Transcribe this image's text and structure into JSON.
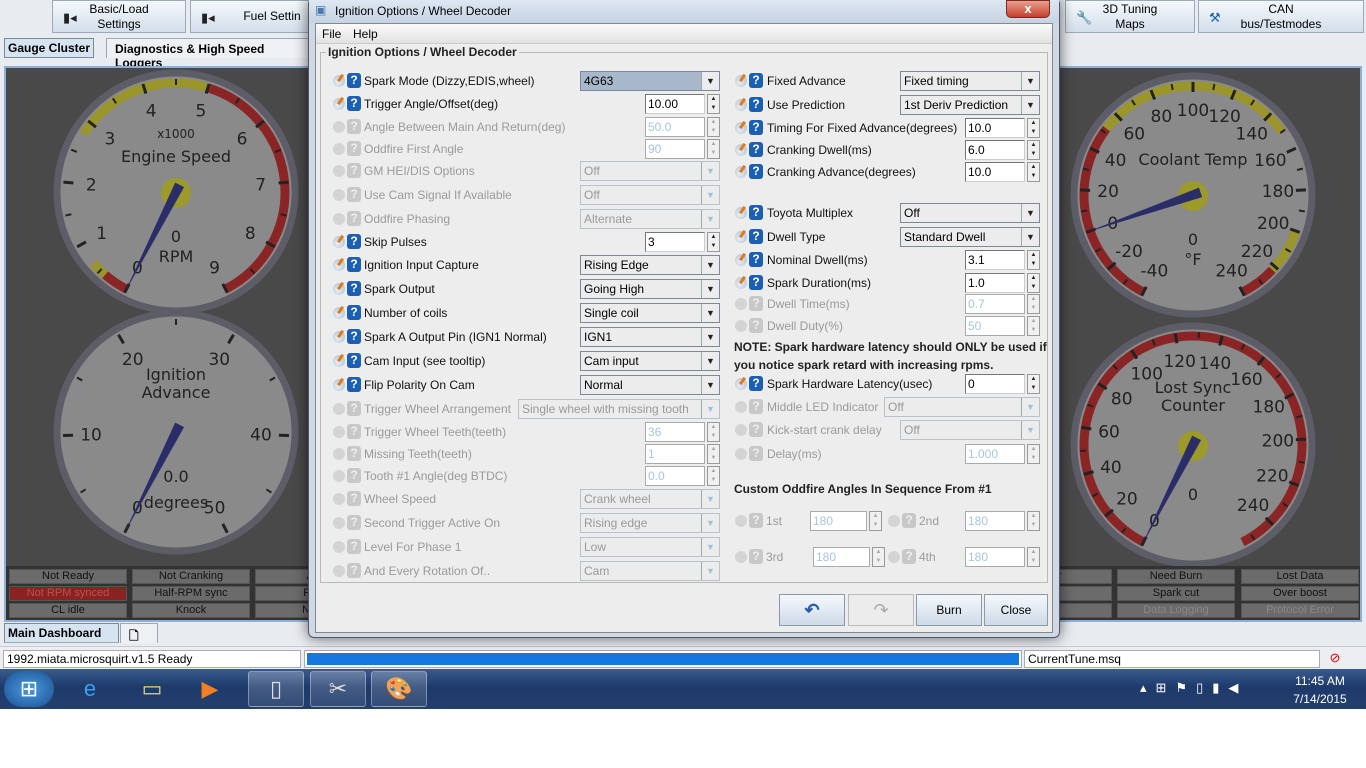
{
  "toolbar": {
    "buttons": [
      {
        "label_l1": "Basic/Load",
        "label_l2": "Settings",
        "icon": "settings-icon"
      },
      {
        "label_l1": "Fuel Settin",
        "label_l2": "",
        "icon": "settings-icon"
      },
      {
        "label_l1": "3D Tuning",
        "label_l2": "Maps",
        "icon": "wrench-icon"
      },
      {
        "label_l1": "CAN",
        "label_l2": "bus/Testmodes",
        "icon": "tools-icon"
      }
    ]
  },
  "tabs": [
    {
      "label": "Gauge Cluster",
      "selected": true
    },
    {
      "label": "Diagnostics & High Speed Loggers",
      "selected": false
    }
  ],
  "gauges": [
    {
      "name": "engine-speed",
      "title": [
        "Engine Speed"
      ],
      "subtitle": "x1000",
      "value_text": "0",
      "units": "RPM",
      "min": 0,
      "max": 9,
      "value": 0,
      "labels": [
        0,
        1,
        2,
        3,
        4,
        5,
        6,
        7,
        8,
        9
      ],
      "minor": 2,
      "hub": true,
      "bands": [
        {
          "from": 0,
          "to": 0.4,
          "color": "#8b2525"
        },
        {
          "from": 0.4,
          "to": 0.65,
          "color": "#9a962a"
        },
        {
          "from": 2.8,
          "to": 5,
          "color": "#9a962a"
        },
        {
          "from": 5,
          "to": 9,
          "color": "#8b2525"
        }
      ]
    },
    {
      "name": "ignition-advance",
      "title": [
        "Ignition",
        "Advance"
      ],
      "subtitle": "",
      "value_text": "0.0",
      "units": "degrees",
      "min": 0,
      "max": 50,
      "value": 0,
      "labels": [
        0,
        10,
        20,
        30,
        40,
        50
      ],
      "minor": 2,
      "hub": false,
      "bands": []
    },
    {
      "name": "coolant-temp",
      "title": [
        "Coolant Temp"
      ],
      "subtitle": "",
      "value_text": "0",
      "units": "°F",
      "min": -40,
      "max": 240,
      "value": 0,
      "labels": [
        -40,
        -20,
        0,
        20,
        40,
        60,
        80,
        100,
        120,
        140,
        160,
        180,
        200,
        220,
        240
      ],
      "minor": 2,
      "hub": true,
      "bands": [
        {
          "from": -40,
          "to": 52,
          "color": "#8b2525"
        },
        {
          "from": 52,
          "to": 150,
          "color": "#9a962a"
        },
        {
          "from": 200,
          "to": 222,
          "color": "#9a962a"
        },
        {
          "from": 222,
          "to": 240,
          "color": "#8b2525"
        }
      ]
    },
    {
      "name": "lost-sync-counter",
      "title": [
        "Lost Sync",
        "Counter"
      ],
      "subtitle": "",
      "value_text": "0",
      "units": "",
      "min": 0,
      "max": 255,
      "value": 0,
      "labels": [
        0,
        20,
        40,
        60,
        80,
        100,
        120,
        140,
        160,
        180,
        200,
        220,
        240
      ],
      "minor": 2,
      "hub": true,
      "bands": [
        {
          "from": 0,
          "to": 255,
          "color": "#8b2525"
        }
      ]
    }
  ],
  "indicators_left": [
    [
      "Not Ready",
      "Not Cranking",
      "AS"
    ],
    [
      "Not RPM synced",
      "Half-RPM sync",
      "Fuel"
    ],
    [
      "CL idle",
      "Knock",
      "No F"
    ]
  ],
  "indicators_right": [
    [
      "rror",
      "Need Burn",
      "Lost Data"
    ],
    [
      "ift",
      "Spark cut",
      "Over boost"
    ],
    [
      "",
      "Data Logging",
      "Protocol Error"
    ]
  ],
  "indicator_states": {
    "red": "Not RPM synced",
    "disabled": [
      "Data Logging",
      "Protocol Error"
    ]
  },
  "dashboard_tabs": {
    "main": "Main Dashboard"
  },
  "status": {
    "left": "1992.miata.microsquirt.v1.5 Ready",
    "progress": 1.0,
    "file": "CurrentTune.msq"
  },
  "taskbar": {
    "time": "11:45 AM",
    "date": "7/14/2015"
  },
  "dialog": {
    "title": "Ignition Options / Wheel Decoder",
    "menu": [
      "File",
      "Help"
    ],
    "group_title": "Ignition Options / Wheel Decoder",
    "left_rows": [
      {
        "label": "Spark Mode (Dizzy,EDIS,wheel)",
        "type": "select",
        "value": "4G63",
        "enabled": true,
        "highlight": true
      },
      {
        "label": "Trigger Angle/Offset(deg)",
        "type": "spin",
        "value": "10.00",
        "enabled": true
      },
      {
        "label": "Angle Between Main And Return(deg)",
        "type": "spin",
        "value": "50.0",
        "enabled": false
      },
      {
        "label": "Oddfire First Angle",
        "type": "spin",
        "value": "90",
        "enabled": false
      },
      {
        "label": "GM HEI/DIS Options",
        "type": "select",
        "value": "Off",
        "enabled": false
      },
      {
        "label": "Use Cam Signal If Available",
        "type": "select",
        "value": "Off",
        "enabled": false
      },
      {
        "label": "Oddfire Phasing",
        "type": "select",
        "value": "Alternate",
        "enabled": false
      },
      {
        "label": "Skip Pulses",
        "type": "spin",
        "value": "3",
        "enabled": true
      },
      {
        "label": "Ignition Input Capture",
        "type": "select",
        "value": "Rising Edge",
        "enabled": true
      },
      {
        "label": "Spark Output",
        "type": "select",
        "value": "Going High",
        "enabled": true
      },
      {
        "label": "Number of coils",
        "type": "select",
        "value": "Single coil",
        "enabled": true
      },
      {
        "label": "Spark A Output Pin (IGN1 Normal)",
        "type": "select",
        "value": "IGN1",
        "enabled": true
      },
      {
        "label": "Cam Input (see tooltip)",
        "type": "select",
        "value": "Cam input",
        "enabled": true
      },
      {
        "label": "Flip Polarity On Cam",
        "type": "select",
        "value": "Normal",
        "enabled": true
      },
      {
        "label": "Trigger Wheel Arrangement",
        "type": "select-wide",
        "value": "Single wheel with missing tooth",
        "enabled": false
      },
      {
        "label": "Trigger Wheel Teeth(teeth)",
        "type": "spin",
        "value": "36",
        "enabled": false
      },
      {
        "label": "Missing Teeth(teeth)",
        "type": "spin",
        "value": "1",
        "enabled": false
      },
      {
        "label": "Tooth #1 Angle(deg BTDC)",
        "type": "spin",
        "value": "0.0",
        "enabled": false
      },
      {
        "label": "Wheel Speed",
        "type": "select",
        "value": "Crank wheel",
        "enabled": false
      },
      {
        "label": "Second Trigger Active On",
        "type": "select",
        "value": "Rising edge",
        "enabled": false
      },
      {
        "label": "Level For Phase 1",
        "type": "select",
        "value": "Low",
        "enabled": false
      },
      {
        "label": "And Every Rotation Of..",
        "type": "select",
        "value": "Cam",
        "enabled": false
      }
    ],
    "right_rows": [
      {
        "label": "Fixed Advance",
        "type": "select",
        "value": "Fixed timing",
        "enabled": true
      },
      {
        "label": "Use Prediction",
        "type": "select",
        "value": "1st Deriv Prediction",
        "enabled": true
      },
      {
        "label": "Timing For Fixed Advance(degrees)",
        "type": "spin",
        "value": "10.0",
        "enabled": true
      },
      {
        "label": "Cranking Dwell(ms)",
        "type": "spin",
        "value": "6.0",
        "enabled": true
      },
      {
        "label": "Cranking Advance(degrees)",
        "type": "spin",
        "value": "10.0",
        "enabled": true
      },
      {
        "label": "Toyota Multiplex",
        "type": "select",
        "value": "Off",
        "enabled": true
      },
      {
        "label": "Dwell Type",
        "type": "select",
        "value": "Standard Dwell",
        "enabled": true
      },
      {
        "label": "Nominal Dwell(ms)",
        "type": "spin",
        "value": "3.1",
        "enabled": true
      },
      {
        "label": "Spark Duration(ms)",
        "type": "spin",
        "value": "1.0",
        "enabled": true
      },
      {
        "label": "Dwell Time(ms)",
        "type": "spin",
        "value": "0.7",
        "enabled": false
      },
      {
        "label": "Dwell Duty(%)",
        "type": "spin",
        "value": "50",
        "enabled": false
      },
      {
        "label": "Spark Hardware Latency(usec)",
        "type": "spin",
        "value": "0",
        "enabled": true
      },
      {
        "label": "Middle LED Indicator",
        "type": "select-mid",
        "value": "Off",
        "enabled": false
      },
      {
        "label": "Kick-start crank delay",
        "type": "select",
        "value": "Off",
        "enabled": false
      },
      {
        "label": "Delay(ms)",
        "type": "spin",
        "value": "1.000",
        "enabled": false
      }
    ],
    "note_l1": "NOTE: Spark hardware latency should ONLY be used if",
    "note_l2": "you notice spark retard with increasing rpms.",
    "oddfire_heading": "Custom Oddfire Angles In Sequence From #1",
    "oddfire": [
      {
        "label": "1st",
        "value": "180"
      },
      {
        "label": "2nd",
        "value": "180"
      },
      {
        "label": "3rd",
        "value": "180"
      },
      {
        "label": "4th",
        "value": "180"
      }
    ],
    "buttons": {
      "undo": "undo-icon",
      "redo": "redo-icon",
      "burn": "Burn",
      "close": "Close"
    }
  }
}
